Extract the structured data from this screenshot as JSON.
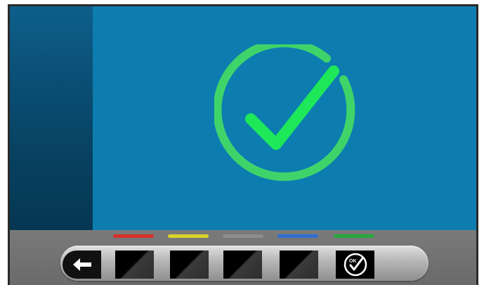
{
  "screen": {
    "status_icon": "check-circle-icon",
    "colors": {
      "left_panel": "#0a4e74",
      "main_area": "#0d7db0",
      "check_ring": "#3fd46a",
      "check_mark": "#1ee85a"
    }
  },
  "bottom_bar": {
    "color_strips": [
      {
        "color": "#d9302a"
      },
      {
        "color": "#d8d629"
      },
      {
        "color": "#8e8e8e"
      },
      {
        "color": "#2f6fd0"
      },
      {
        "color": "#27a83b"
      }
    ],
    "buttons": [
      {
        "icon": "back-arrow-icon"
      },
      {
        "icon": "blank-key-icon"
      },
      {
        "icon": "blank-key-icon"
      },
      {
        "icon": "blank-key-icon"
      },
      {
        "icon": "blank-key-icon"
      },
      {
        "icon": "ok-check-icon",
        "label": "OK"
      }
    ]
  }
}
